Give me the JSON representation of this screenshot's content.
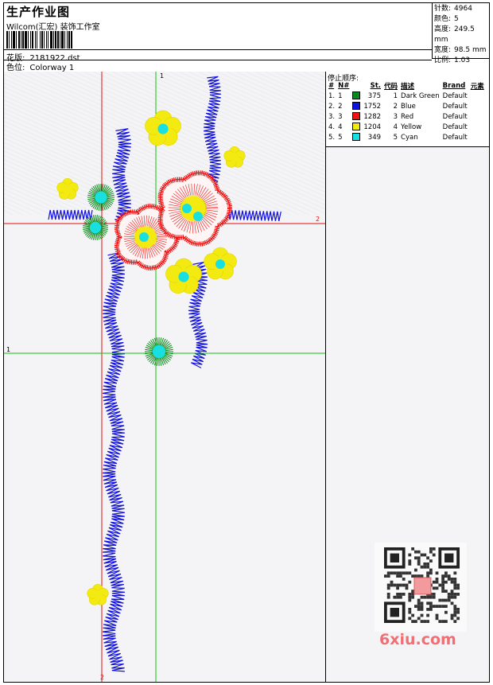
{
  "header": {
    "title": "生产作业图",
    "studio": "Wilcom(汇宏) 装饰工作室",
    "design_label": "花版:",
    "design_file": "2181922.dst",
    "colorway_label": "色位:",
    "colorway": "Colorway 1"
  },
  "stats": [
    {
      "label": "针数:",
      "value": "4964"
    },
    {
      "label": "颜色:",
      "value": "5"
    },
    {
      "label": "高度:",
      "value": "249.5 mm"
    },
    {
      "label": "宽度:",
      "value": "98.5 mm"
    },
    {
      "label": "比例:",
      "value": "1.03"
    }
  ],
  "stop_sequence": {
    "title": "停止顺序:",
    "columns": [
      "#",
      "N#",
      "St.",
      "代码",
      "描述",
      "Brand",
      "元素"
    ],
    "rows": [
      {
        "idx": "1.",
        "n": "1",
        "color": "#0a8a1a",
        "stitches": "375",
        "code": "1",
        "desc": "Dark Green",
        "brand": "Default"
      },
      {
        "idx": "2.",
        "n": "2",
        "color": "#1010e0",
        "stitches": "1752",
        "code": "2",
        "desc": "Blue",
        "brand": "Default"
      },
      {
        "idx": "3.",
        "n": "3",
        "color": "#ee1111",
        "stitches": "1282",
        "code": "3",
        "desc": "Red",
        "brand": "Default"
      },
      {
        "idx": "4.",
        "n": "4",
        "color": "#f2ea10",
        "stitches": "1204",
        "code": "4",
        "desc": "Yellow",
        "brand": "Default"
      },
      {
        "idx": "5.",
        "n": "5",
        "color": "#18e0e0",
        "stitches": "349",
        "code": "5",
        "desc": "Cyan",
        "brand": "Default"
      }
    ]
  },
  "axis_labels": {
    "v1": "1",
    "h2": "2",
    "h1": "1",
    "v2": "2"
  },
  "watermark": {
    "site": "6xiu.com"
  },
  "colors": {
    "dark_green": "#0a8a1a",
    "blue": "#1010e0",
    "red": "#ee1111",
    "yellow": "#f2ea10",
    "cyan": "#18e0e0",
    "guide_red": "#e01010",
    "guide_green": "#10c010"
  }
}
